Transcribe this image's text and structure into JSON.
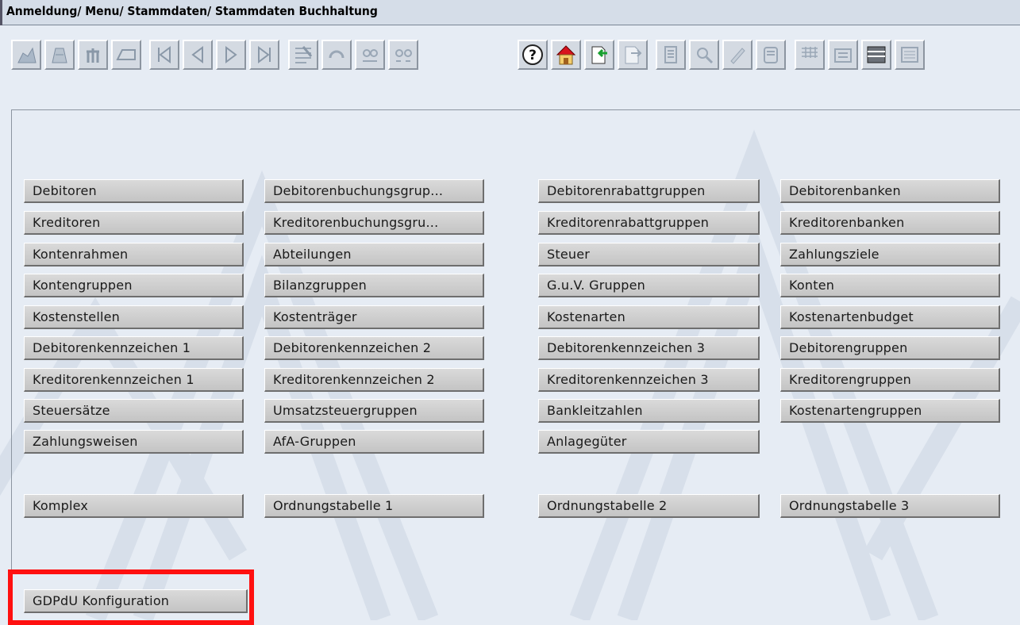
{
  "window": {
    "title": "Anmeldung/ Menu/ Stammdaten/ Stammdaten Buchhaltung"
  },
  "toolbar": [
    {
      "name": "new-record-icon",
      "enabled": false
    },
    {
      "name": "copy-record-icon",
      "enabled": false
    },
    {
      "name": "delete-record-icon",
      "enabled": false
    },
    {
      "name": "clear-form-icon",
      "enabled": false
    },
    {
      "name": "first-record-icon",
      "enabled": false
    },
    {
      "name": "previous-record-icon",
      "enabled": false
    },
    {
      "name": "next-record-icon",
      "enabled": false
    },
    {
      "name": "last-record-icon",
      "enabled": false
    },
    {
      "name": "edit-list-icon",
      "enabled": false
    },
    {
      "name": "refresh-icon",
      "enabled": false
    },
    {
      "name": "link-icon",
      "enabled": false
    },
    {
      "name": "unlink-icon",
      "enabled": false
    },
    {
      "name": "help-icon",
      "enabled": true
    },
    {
      "name": "home-icon",
      "enabled": true
    },
    {
      "name": "export-icon",
      "enabled": true
    },
    {
      "name": "import-icon",
      "enabled": false
    },
    {
      "name": "print-icon",
      "enabled": false
    },
    {
      "name": "search-icon",
      "enabled": false
    },
    {
      "name": "edit-icon",
      "enabled": false
    },
    {
      "name": "save-icon",
      "enabled": false
    },
    {
      "name": "grid-icon",
      "enabled": false
    },
    {
      "name": "form-icon",
      "enabled": false
    },
    {
      "name": "list-view-icon",
      "enabled": true
    },
    {
      "name": "detail-view-icon",
      "enabled": false
    }
  ],
  "menu": {
    "rows": [
      [
        "Debitoren",
        "Debitorenbuchungsgrup...",
        "Debitorenrabattgruppen",
        "Debitorenbanken"
      ],
      [
        "Kreditoren",
        "Kreditorenbuchungsgru...",
        "Kreditorenrabattgruppen",
        "Kreditorenbanken"
      ],
      [
        "Kontenrahmen",
        "Abteilungen",
        "Steuer",
        "Zahlungsziele"
      ],
      [
        "Kontengruppen",
        "Bilanzgruppen",
        "G.u.V. Gruppen",
        "Konten"
      ],
      [
        "Kostenstellen",
        "Kostenträger",
        "Kostenarten",
        "Kostenartenbudget"
      ],
      [
        "Debitorenkennzeichen 1",
        "Debitorenkennzeichen 2",
        "Debitorenkennzeichen 3",
        "Debitorengruppen"
      ],
      [
        "Kreditorenkennzeichen 1",
        "Kreditorenkennzeichen 2",
        "Kreditorenkennzeichen 3",
        "Kreditorengruppen"
      ],
      [
        "Steuersätze",
        "Umsatzsteuergruppen",
        "Bankleitzahlen",
        "Kostenartengruppen"
      ],
      [
        "Zahlungsweisen",
        "AfA-Gruppen",
        "Anlagegüter",
        ""
      ]
    ],
    "extra_row": [
      "Komplex",
      "Ordnungstabelle 1",
      "Ordnungstabelle 2",
      "Ordnungstabelle 3"
    ],
    "gdpdu_label": "GDPdU Konfiguration"
  },
  "colors": {
    "background": "#e6ecf4",
    "highlight": "#ff1010",
    "button": "#d0d0d0"
  }
}
